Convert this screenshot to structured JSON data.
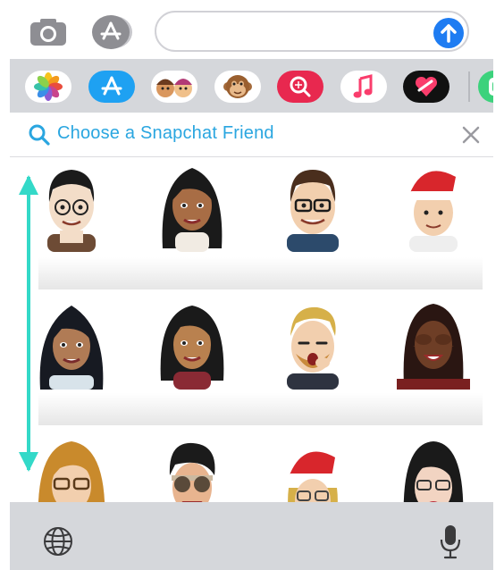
{
  "compose": {
    "message_placeholder": "",
    "icons": [
      "camera-icon",
      "app-store-icon",
      "send-arrow-icon"
    ],
    "accent_color": "#1e7cf2"
  },
  "app_drawer": {
    "apps": [
      {
        "name": "photos-app-icon"
      },
      {
        "name": "app-store-app-icon"
      },
      {
        "name": "memoji-stickers-app-icon"
      },
      {
        "name": "animoji-app-icon"
      },
      {
        "name": "search-images-app-icon"
      },
      {
        "name": "music-app-icon"
      },
      {
        "name": "digital-touch-app-icon"
      },
      {
        "name": "bitmoji-app-icon"
      }
    ]
  },
  "search": {
    "label": "Choose a Snapchat Friend",
    "color": "#2aa6e0"
  },
  "friends_grid": {
    "rows": 3,
    "columns": 4,
    "visible_avatars": 12
  },
  "keyboard_bar": {
    "icons": [
      "globe-icon",
      "microphone-icon"
    ]
  }
}
